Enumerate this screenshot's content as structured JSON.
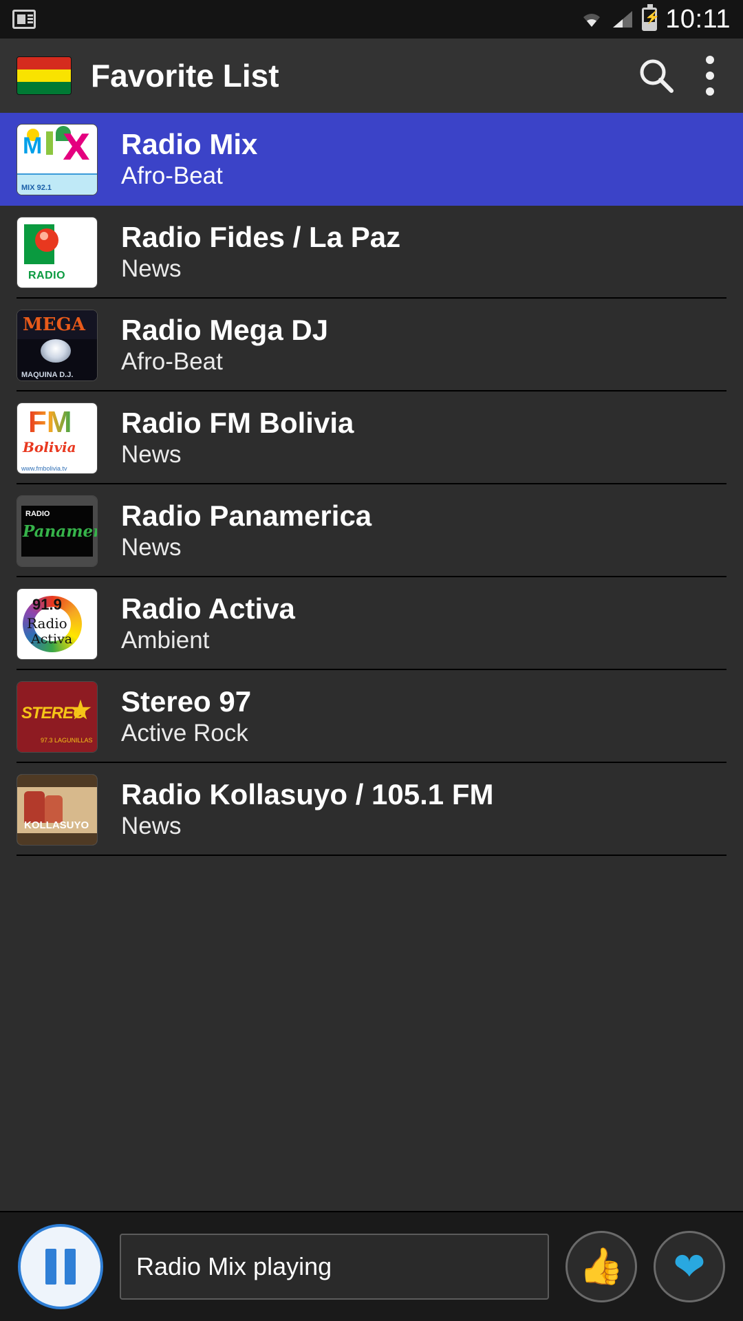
{
  "status_bar": {
    "time": "10:11",
    "icons": [
      "news-icon",
      "wifi-icon",
      "cellular-signal-icon",
      "battery-charging-icon"
    ]
  },
  "app_bar": {
    "title": "Favorite List",
    "flag_colors": [
      "#d52b1e",
      "#f9e300",
      "#007934"
    ],
    "search_icon": "search-icon",
    "overflow_icon": "overflow-menu-icon"
  },
  "colors": {
    "selected_row": "#3b43c8",
    "background": "#2d2d2d",
    "app_bar": "#333333",
    "status_bar": "#141414",
    "bottom_bar": "#1a1a1a",
    "accent_blue": "#2f7fd6",
    "heart_blue": "#29a8e0"
  },
  "stations": [
    {
      "name": "Radio Mix",
      "genre": "Afro-Beat",
      "selected": true,
      "logo": "radio-mix-logo"
    },
    {
      "name": "Radio Fides / La Paz",
      "genre": "News",
      "selected": false,
      "logo": "radio-fides-logo"
    },
    {
      "name": "Radio Mega DJ",
      "genre": "Afro-Beat",
      "selected": false,
      "logo": "radio-mega-dj-logo"
    },
    {
      "name": "Radio FM Bolivia",
      "genre": "News",
      "selected": false,
      "logo": "radio-fm-bolivia-logo"
    },
    {
      "name": "Radio Panamerica",
      "genre": "News",
      "selected": false,
      "logo": "radio-panamericana-logo"
    },
    {
      "name": "Radio Activa",
      "genre": "Ambient",
      "selected": false,
      "logo": "radio-activa-logo"
    },
    {
      "name": "Stereo 97",
      "genre": "Active Rock",
      "selected": false,
      "logo": "stereo-97-logo"
    },
    {
      "name": "Radio Kollasuyo / 105.1 FM",
      "genre": "News",
      "selected": false,
      "logo": "radio-kollasuyo-logo"
    }
  ],
  "player": {
    "play_pause_state": "pause-icon",
    "now_playing": "Radio Mix  playing",
    "like_icon": "thumbs-up-icon",
    "favorite_icon": "heart-icon"
  },
  "thumb_art": {
    "mix": {
      "m": "M",
      "x": "X",
      "caption": "MIX 92.1"
    },
    "fides": {
      "word": "RADIO"
    },
    "mega": {
      "word": "MEGA",
      "sub": "MAQUINA D.J."
    },
    "fm_bolivia": {
      "fm": "FM",
      "bolivia": "Bolivia",
      "url": "www.fmbolivia.tv"
    },
    "panamericana": {
      "r": "RADIO",
      "p": "Panamericana"
    },
    "activa": {
      "num": "91.9",
      "rd": "Radio",
      "ac": "Activa"
    },
    "stereo": {
      "word": "STEREO",
      "sub": "97.3 LAGUNILLAS"
    },
    "kollasuyo": {
      "word": "KOLLASUYO"
    }
  }
}
